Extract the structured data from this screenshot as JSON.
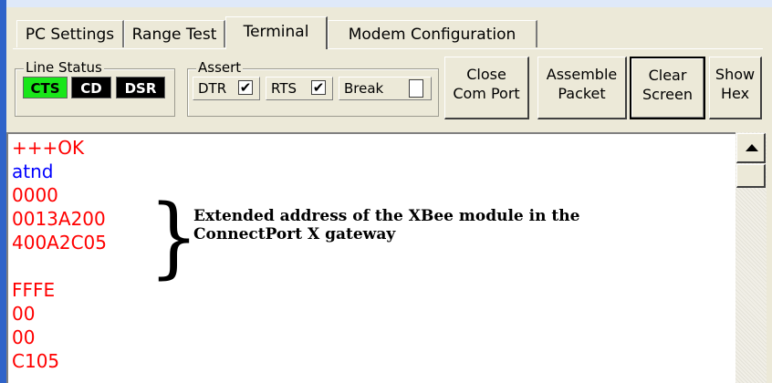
{
  "tabs": [
    {
      "label": "PC Settings"
    },
    {
      "label": "Range Test"
    },
    {
      "label": "Terminal"
    },
    {
      "label": "Modem Configuration"
    }
  ],
  "active_tab": "Terminal",
  "line_status": {
    "title": "Line Status",
    "indicators": [
      {
        "label": "CTS",
        "state": "on",
        "color": "#19e619"
      },
      {
        "label": "CD",
        "state": "off",
        "color": "#000000"
      },
      {
        "label": "DSR",
        "state": "off",
        "color": "#000000"
      }
    ]
  },
  "assert": {
    "title": "Assert",
    "items": [
      {
        "label": "DTR",
        "checked": true,
        "mark": "✔"
      },
      {
        "label": "RTS",
        "checked": true,
        "mark": "✔"
      },
      {
        "label": "Break",
        "checked": false,
        "mark": ""
      }
    ]
  },
  "buttons": {
    "close_com_port": [
      "Close",
      "Com Port"
    ],
    "assemble_packet": [
      "Assemble",
      "Packet"
    ],
    "clear_screen": [
      "Clear",
      "Screen"
    ],
    "show_hex": [
      "Show",
      "Hex"
    ]
  },
  "terminal": {
    "lines": [
      {
        "text": "+++OK",
        "kind": "received"
      },
      {
        "text": "atnd",
        "kind": "sent"
      },
      {
        "text": "0000",
        "kind": "received"
      },
      {
        "text": "0013A200",
        "kind": "received"
      },
      {
        "text": "400A2C05",
        "kind": "received"
      },
      {
        "text": "",
        "kind": "received"
      },
      {
        "text": "FFFE",
        "kind": "received"
      },
      {
        "text": "00",
        "kind": "received"
      },
      {
        "text": "00",
        "kind": "received"
      },
      {
        "text": "C105",
        "kind": "received"
      }
    ],
    "colors": {
      "sent": "#0000ff",
      "received": "#ff0000"
    }
  },
  "annotation": {
    "brace": "}",
    "text": "Extended address of the XBee module in the ConnectPort X gateway"
  },
  "theme": {
    "frame": "#2f63c9",
    "panel": "#ece9d8"
  }
}
